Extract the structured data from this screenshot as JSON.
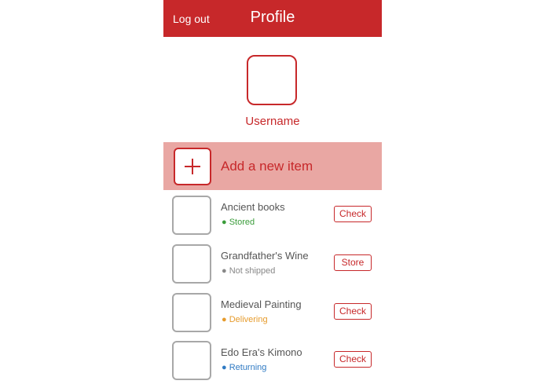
{
  "header": {
    "logout_label": "Log out",
    "title": "Profile"
  },
  "profile": {
    "username": "Username"
  },
  "add_item": {
    "label": "Add a new item",
    "icon": "plus-icon"
  },
  "items": [
    {
      "name": "Ancient books",
      "status": "● Stored",
      "status_color": "#3a9c3a",
      "action": "Check"
    },
    {
      "name": "Grandfather's Wine",
      "status": "● Not shipped",
      "status_color": "#888888",
      "action": "Store"
    },
    {
      "name": "Medieval Painting",
      "status": "● Delivering",
      "status_color": "#e69b2c",
      "action": "Check"
    },
    {
      "name": "Edo Era's Kimono",
      "status": "● Returning",
      "status_color": "#2f7ac3",
      "action": "Check"
    }
  ],
  "colors": {
    "accent": "#c7282a",
    "add_row_bg": "#e9a7a3"
  }
}
